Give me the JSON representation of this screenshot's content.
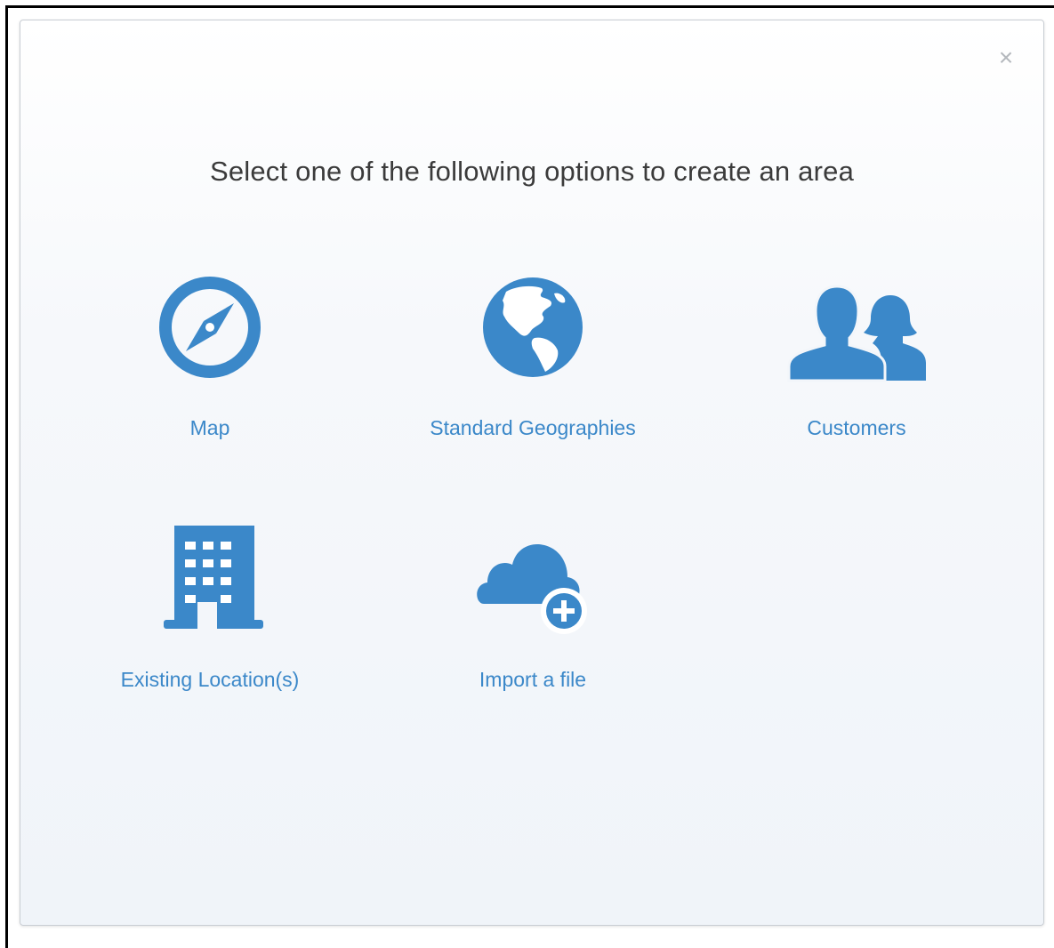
{
  "dialog": {
    "title": "Select one of the following options to create an area",
    "close_icon": "close-icon",
    "accent_color": "#3b88c9"
  },
  "options": [
    {
      "label": "Map",
      "icon": "compass-icon"
    },
    {
      "label": "Standard Geographies",
      "icon": "globe-icon"
    },
    {
      "label": "Customers",
      "icon": "people-icon"
    },
    {
      "label": "Existing Location(s)",
      "icon": "building-icon"
    },
    {
      "label": "Import a file",
      "icon": "cloud-add-icon"
    }
  ]
}
